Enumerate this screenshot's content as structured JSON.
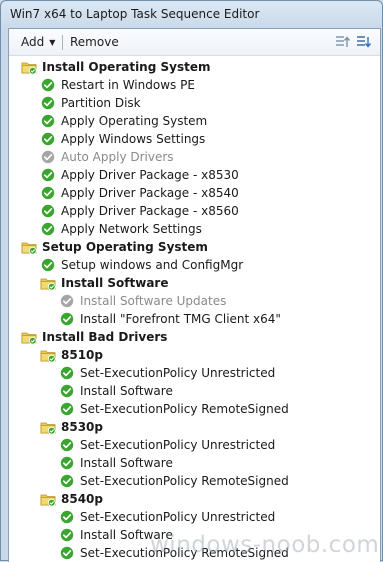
{
  "window": {
    "title": "Win7 x64 to Laptop Task Sequence Editor"
  },
  "toolbar": {
    "add_label": "Add",
    "remove_label": "Remove"
  },
  "colors": {
    "folder": "#e9c84f",
    "check": "#3aa52f",
    "check_disabled": "#a6a6a6"
  },
  "tree": [
    {
      "label": "Install Operating System",
      "type": "group",
      "depth": 0
    },
    {
      "label": "Restart in Windows PE",
      "type": "step",
      "depth": 1
    },
    {
      "label": "Partition Disk",
      "type": "step",
      "depth": 1
    },
    {
      "label": "Apply Operating System",
      "type": "step",
      "depth": 1
    },
    {
      "label": "Apply Windows Settings",
      "type": "step",
      "depth": 1
    },
    {
      "label": "Auto Apply Drivers",
      "type": "step",
      "depth": 1,
      "disabled": true
    },
    {
      "label": "Apply Driver Package - x8530",
      "type": "step",
      "depth": 1
    },
    {
      "label": "Apply Driver Package - x8540",
      "type": "step",
      "depth": 1
    },
    {
      "label": "Apply Driver Package - x8560",
      "type": "step",
      "depth": 1
    },
    {
      "label": "Apply Network Settings",
      "type": "step",
      "depth": 1
    },
    {
      "label": "Setup Operating System",
      "type": "group",
      "depth": 0
    },
    {
      "label": "Setup windows and ConfigMgr",
      "type": "step",
      "depth": 1
    },
    {
      "label": "Install Software",
      "type": "group",
      "depth": 1
    },
    {
      "label": "Install Software Updates",
      "type": "step",
      "depth": 2,
      "disabled": true
    },
    {
      "label": "Install \"Forefront TMG Client x64\"",
      "type": "step",
      "depth": 2
    },
    {
      "label": "Install Bad Drivers",
      "type": "group",
      "depth": 0
    },
    {
      "label": "8510p",
      "type": "group",
      "depth": 1
    },
    {
      "label": "Set-ExecutionPolicy Unrestricted",
      "type": "step",
      "depth": 2
    },
    {
      "label": "Install Software",
      "type": "step",
      "depth": 2
    },
    {
      "label": "Set-ExecutionPolicy RemoteSigned",
      "type": "step",
      "depth": 2
    },
    {
      "label": "8530p",
      "type": "group",
      "depth": 1
    },
    {
      "label": "Set-ExecutionPolicy Unrestricted",
      "type": "step",
      "depth": 2
    },
    {
      "label": "Install Software",
      "type": "step",
      "depth": 2
    },
    {
      "label": "Set-ExecutionPolicy RemoteSigned",
      "type": "step",
      "depth": 2
    },
    {
      "label": "8540p",
      "type": "group",
      "depth": 1
    },
    {
      "label": "Set-ExecutionPolicy Unrestricted",
      "type": "step",
      "depth": 2
    },
    {
      "label": "Install Software",
      "type": "step",
      "depth": 2
    },
    {
      "label": "Set-ExecutionPolicy RemoteSigned",
      "type": "step",
      "depth": 2
    }
  ],
  "watermark": "windows-noob.com"
}
